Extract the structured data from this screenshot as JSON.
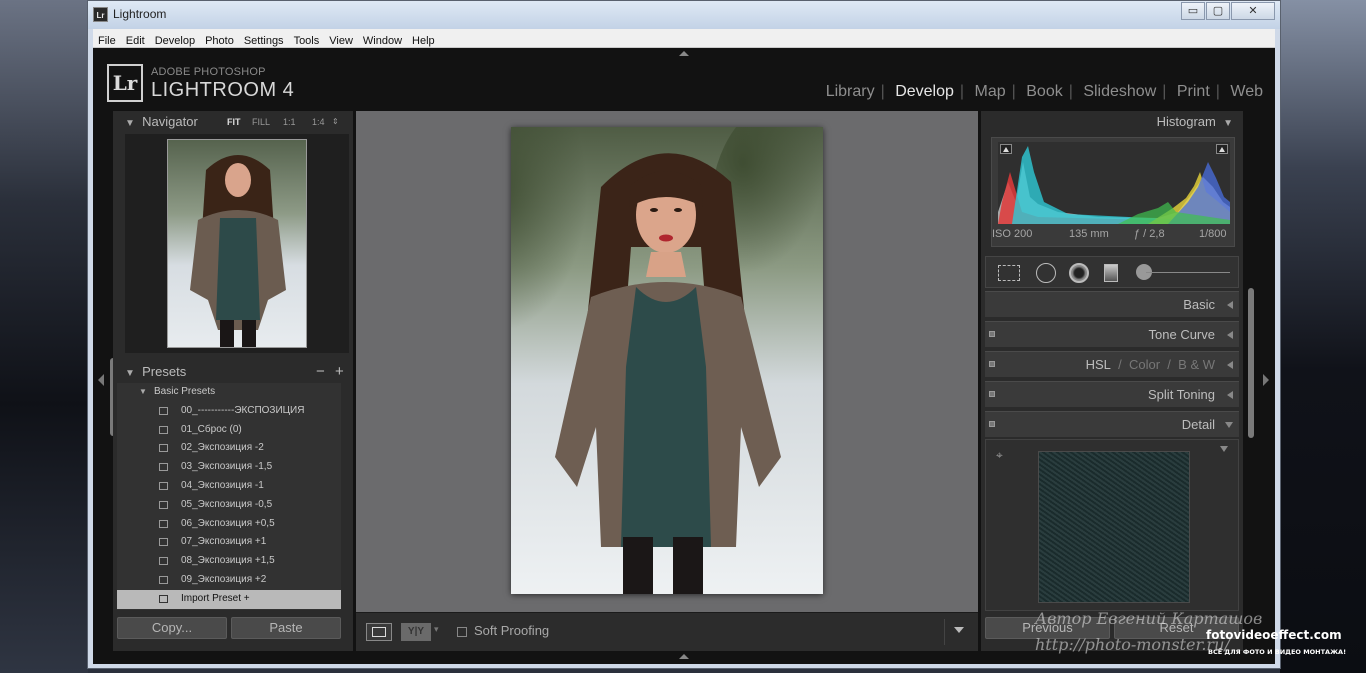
{
  "window": {
    "title": "Lightroom",
    "app_icon": "Lr",
    "minimize": "▭",
    "maximize": "▢",
    "close": "✕"
  },
  "menu": [
    "File",
    "Edit",
    "Develop",
    "Photo",
    "Settings",
    "Tools",
    "View",
    "Window",
    "Help"
  ],
  "brand": {
    "logo": "Lr",
    "line1": "ADOBE PHOTOSHOP",
    "line2": "LIGHTROOM 4"
  },
  "modules": [
    "Library",
    "Develop",
    "Map",
    "Book",
    "Slideshow",
    "Print",
    "Web"
  ],
  "active_module": "Develop",
  "navigator": {
    "title": "Navigator",
    "zoom": [
      "FIT",
      "FILL",
      "1:1",
      "1:4"
    ]
  },
  "presets": {
    "title": "Presets",
    "folder": "Basic Presets",
    "items": [
      "00_-----------ЭКСПОЗИЦИЯ",
      "01_Сброс (0)",
      "02_Экспозиция -2",
      "03_Экспозиция -1,5",
      "04_Экспозиция -1",
      "05_Экспозиция -0,5",
      "06_Экспозиция +0,5",
      "07_Экспозиция +1",
      "08_Экспозиция +1,5",
      "09_Экспозиция +2"
    ],
    "import": "Import Preset  +",
    "minus": "−",
    "plus": "+"
  },
  "left_buttons": {
    "copy": "Copy...",
    "paste": "Paste"
  },
  "toolbar": {
    "soft_proofing": "Soft Proofing",
    "compare": "Y|Y"
  },
  "histogram": {
    "title": "Histogram",
    "iso": "ISO 200",
    "focal": "135 mm",
    "aperture": "ƒ / 2,8",
    "shutter": "1/800"
  },
  "sections": {
    "basic": "Basic",
    "tone_curve": "Tone Curve",
    "hsl": "HSL",
    "color": "Color",
    "bw": "B & W",
    "split": "Split Toning",
    "detail": "Detail",
    "hsl_sep": "/"
  },
  "right_buttons": {
    "previous": "Previous",
    "reset": "Reset"
  },
  "watermark": {
    "author": "Автор Евгений Карташов",
    "site": "http://photo-monster.ru/",
    "brand": "fotovideoeffect.com",
    "tagline": "ВСЁ ДЛЯ ФОТО И ВИДЕО МОНТАЖА!"
  }
}
